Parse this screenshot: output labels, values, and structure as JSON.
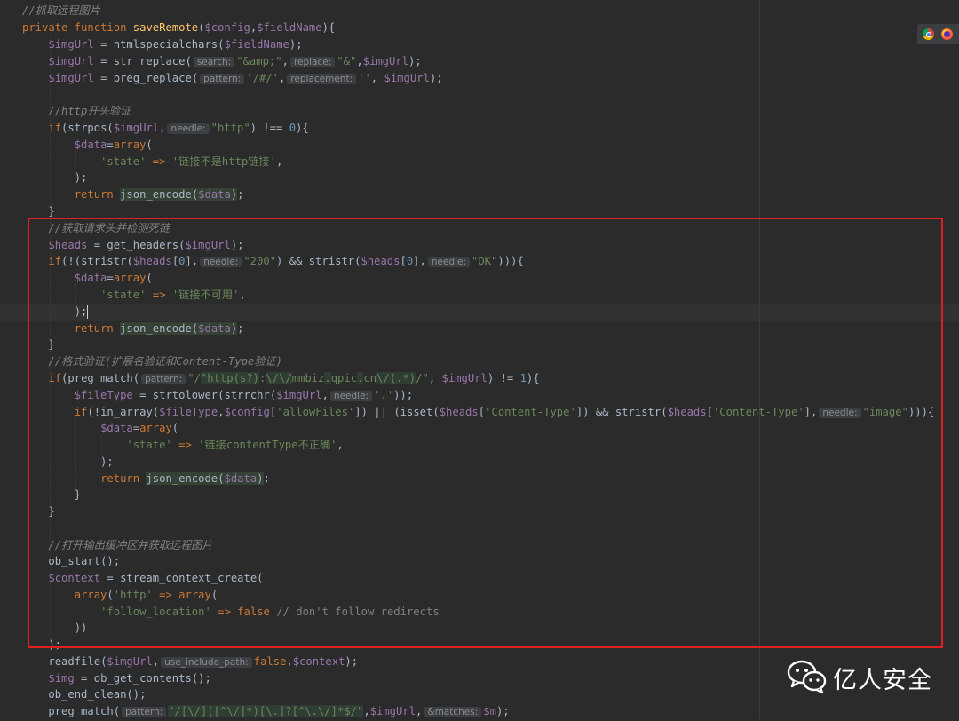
{
  "code": {
    "l1_comment": "//抓取远程图片",
    "l2_private": "private",
    "l2_function": "function",
    "l2_name": "saveRemote",
    "l2_p1": "$config",
    "l2_p2": "$fieldName",
    "l3_var": "$imgUrl",
    "l3_fn": "htmlspecialchars",
    "l3_arg": "$fieldName",
    "l4_var": "$imgUrl",
    "l4_fn": "str_replace",
    "l4_hint1": "search:",
    "l4_s1": "\"&amp;\"",
    "l4_hint2": "replace:",
    "l4_s2": "\"&\"",
    "l4_arg": "$imgUrl",
    "l5_var": "$imgUrl",
    "l5_fn": "preg_replace",
    "l5_hint1": "pattern:",
    "l5_s1": "'/#/'",
    "l5_hint2": "replacement:",
    "l5_s2": "''",
    "l5_arg": "$imgUrl",
    "l7_comment": "//http开头验证",
    "l8_if": "if",
    "l8_fn": "strpos",
    "l8_var": "$imgUrl",
    "l8_hint": "needle:",
    "l8_s": "\"http\"",
    "l8_op": ") !== ",
    "l8_num": "0",
    "l9_var": "$data",
    "l9_arr": "array",
    "l10_key": "'state'",
    "l10_val": "'链接不是http链接'",
    "l12_return": "return",
    "l12_fn": "json_encode",
    "l12_var": "$data",
    "l14_comment": "//获取请求头并检测死链",
    "l15_var": "$heads",
    "l15_fn": "get_headers",
    "l15_arg": "$imgUrl",
    "l16_if": "if",
    "l16_fn1": "stristr",
    "l16_var1": "$heads",
    "l16_num1": "0",
    "l16_hint1": "needle:",
    "l16_s1": "\"200\"",
    "l16_fn2": "stristr",
    "l16_var2": "$heads",
    "l16_num2": "0",
    "l16_hint2": "needle:",
    "l16_s2": "\"OK\"",
    "l17_var": "$data",
    "l17_arr": "array",
    "l18_key": "'state'",
    "l18_val": "'链接不可用'",
    "l20_return": "return",
    "l20_fn": "json_encode",
    "l20_var": "$data",
    "l22_comment": "//格式验证(扩展名验证和Content-Type验证)",
    "l23_if": "if",
    "l23_fn": "preg_match",
    "l23_hint": "pattern:",
    "l23_r1": "\"/",
    "l23_r2": "^http",
    "l23_r3": "(s?)",
    "l23_r4": ":",
    "l23_r5": "\\/\\/",
    "l23_r6": "mmbiz",
    "l23_r7": ".",
    "l23_r8": "qpic",
    "l23_r9": ".",
    "l23_r10": "cn",
    "l23_r11": "\\/",
    "l23_r12": "(.*)",
    "l23_r13": "/\"",
    "l23_var": "$imgUrl",
    "l23_num": "1",
    "l24_var": "$fileType",
    "l24_fn1": "strtolower",
    "l24_fn2": "strrchr",
    "l24_arg": "$imgUrl",
    "l24_hint": "needle:",
    "l24_s": "'.'",
    "l25_if": "if",
    "l25_fn1": "in_array",
    "l25_var1": "$fileType",
    "l25_var2": "$config",
    "l25_s1": "'allowFiles'",
    "l25_fn2": "isset",
    "l25_var3": "$heads",
    "l25_s2": "'Content-Type'",
    "l25_fn3": "stristr",
    "l25_var4": "$heads",
    "l25_s3": "'Content-Type'",
    "l25_hint": "needle:",
    "l25_s4": "\"image\"",
    "l26_var": "$data",
    "l26_arr": "array",
    "l27_key": "'state'",
    "l27_val": "'链接contentType不正确'",
    "l29_return": "return",
    "l29_fn": "json_encode",
    "l29_var": "$data",
    "l33_comment": "//打开输出缓冲区并获取远程图片",
    "l34_fn": "ob_start",
    "l35_var": "$context",
    "l35_fn": "stream_context_create",
    "l36_arr1": "array",
    "l36_key": "'http'",
    "l36_arr2": "array",
    "l37_key": "'follow_location'",
    "l37_false": "false",
    "l37_comment": "// don't follow redirects",
    "l40_fn": "readfile",
    "l40_var": "$imgUrl",
    "l40_hint": "use_include_path:",
    "l40_false": "false",
    "l40_var2": "$context",
    "l41_var": "$img",
    "l41_fn": "ob_get_contents",
    "l42_fn": "ob_end_clean",
    "l43_fn": "preg_match",
    "l43_hint": "pattern:",
    "l43_rx": "\"/[\\/]([^\\/]*)[\\.]?[^\\.\\/]*$/\"",
    "l43_var": "$imgUrl",
    "l43_hint2": "&matches:",
    "l43_var2": "$m"
  },
  "watermark": {
    "text": "亿人安全",
    "icon": "wechat-icon"
  },
  "browser_icons": [
    "chrome-icon",
    "firefox-icon"
  ],
  "colors": {
    "background": "#2b2b2b",
    "keyword": "#cc7832",
    "function": "#ffc66d",
    "variable": "#9876aa",
    "string": "#6a8759",
    "number": "#6897bb",
    "comment": "#808080",
    "highlight_box": "#e02020"
  }
}
